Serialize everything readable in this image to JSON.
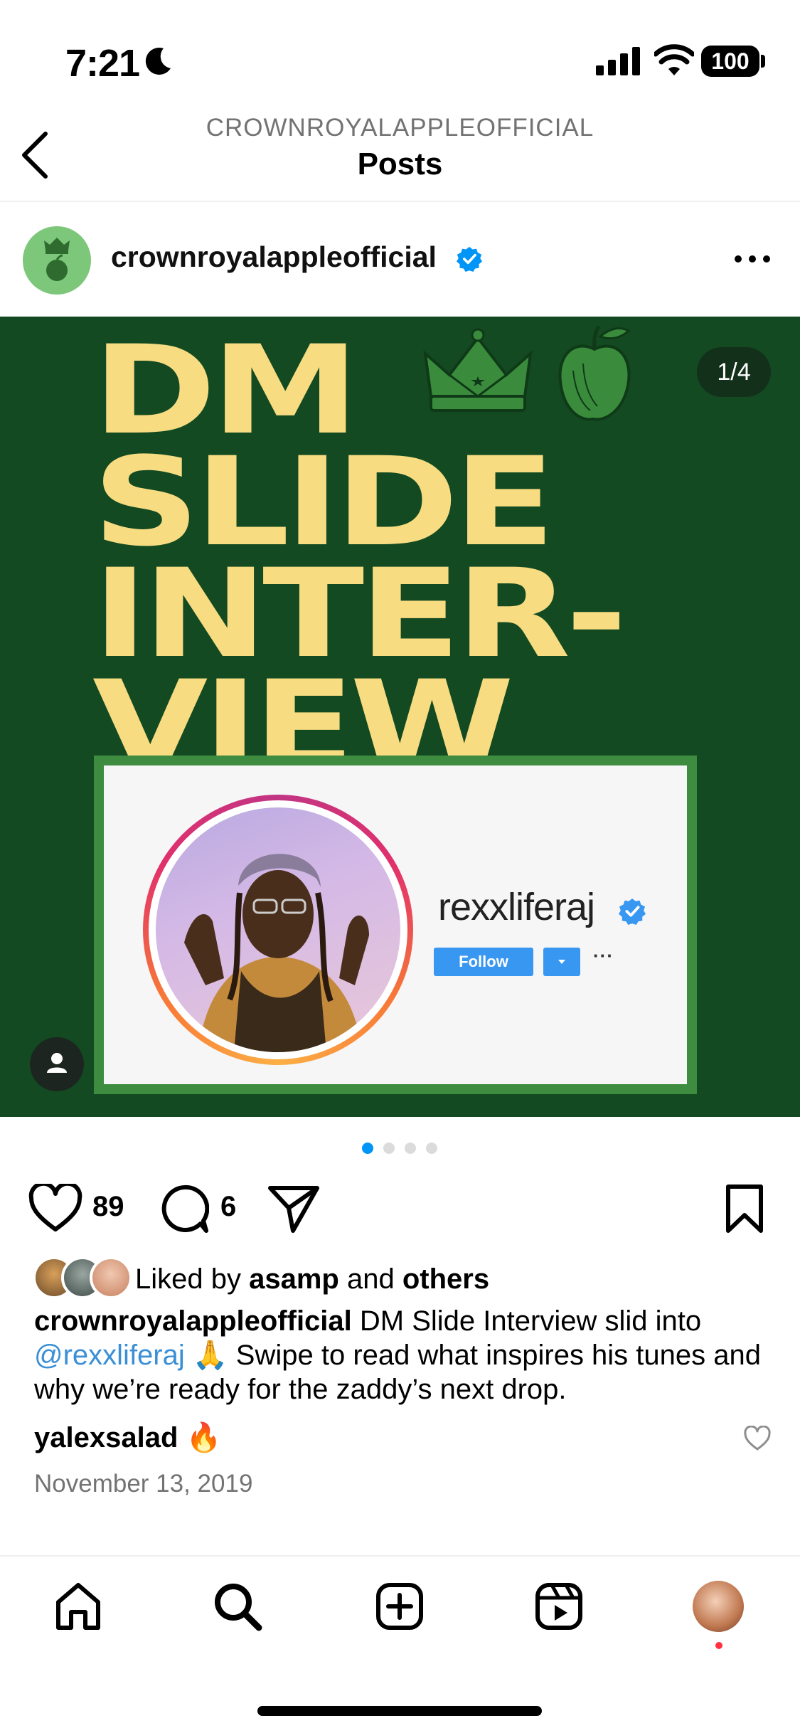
{
  "status_bar": {
    "time": "7:21",
    "battery": "100"
  },
  "header": {
    "username": "CROWNROYALAPPLEOFFICIAL",
    "title": "Posts"
  },
  "post": {
    "username": "crownroyalappleofficial",
    "image": {
      "headline_lines": [
        "DM",
        "SLIDE",
        "INTER-",
        "VIEW"
      ],
      "counter": "1/4",
      "profile_name": "rexxliferaj",
      "follow_label": "Follow",
      "more": "···"
    },
    "likes_count": "89",
    "comments_count": "6",
    "liked_by": {
      "prefix": "Liked by ",
      "user": "asamp",
      "middle": " and ",
      "suffix": "others"
    },
    "caption": {
      "author": "crownroyalappleofficial",
      "text1": " DM Slide Interview slid into ",
      "mention": "@rexxliferaj",
      "text2": " 🙏 Swipe to read what inspires his tunes and why we’re ready for the zaddy’s next drop."
    },
    "comment": {
      "user": "yalexsalad",
      "text": " 🔥"
    },
    "date": "November 13, 2019",
    "carousel": {
      "total": 4,
      "active": 1
    }
  },
  "colors": {
    "brand_green": "#134a22",
    "headline_yellow": "#f8dc82",
    "accent_blue": "#0095f6",
    "notification_red": "#ff3040"
  }
}
